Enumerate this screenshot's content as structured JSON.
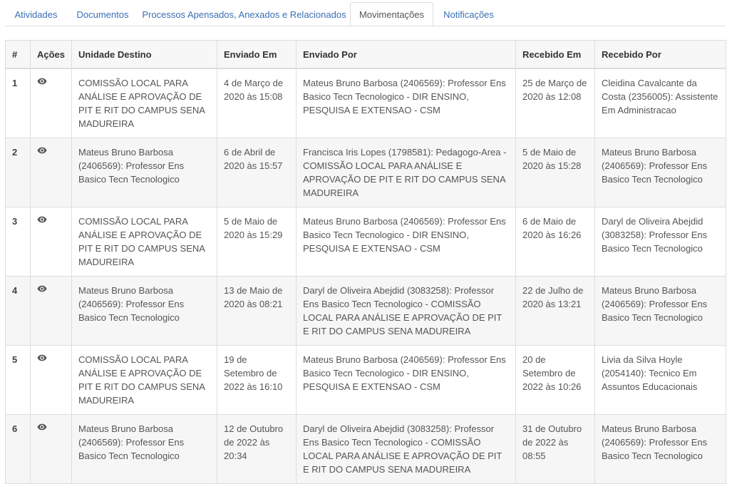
{
  "tabs": [
    {
      "label": "Atividades",
      "active": false
    },
    {
      "label": "Documentos",
      "active": false
    },
    {
      "label": "Processos Apensados, Anexados e Relacionados",
      "active": false
    },
    {
      "label": "Movimentações",
      "active": true
    },
    {
      "label": "Notificações",
      "active": false
    }
  ],
  "table": {
    "headers": {
      "num": "#",
      "acoes": "Ações",
      "unidade_destino": "Unidade Destino",
      "enviado_em": "Enviado Em",
      "enviado_por": "Enviado Por",
      "recebido_em": "Recebido Em",
      "recebido_por": "Recebido Por"
    },
    "rows": [
      {
        "num": "1",
        "unidade_destino": "COMISSÃO LOCAL PARA ANÁLISE E APROVAÇÃO DE PIT E RIT DO CAMPUS SENA MADUREIRA",
        "enviado_em": "4 de Março de 2020 às 15:08",
        "enviado_por": "Mateus Bruno Barbosa (2406569): Professor Ens Basico Tecn Tecnologico - DIR ENSINO, PESQUISA E EXTENSAO - CSM",
        "recebido_em": "25 de Março de 2020 às 12:08",
        "recebido_por": "Cleidina Cavalcante da Costa (2356005): Assistente Em Administracao"
      },
      {
        "num": "2",
        "unidade_destino": "Mateus Bruno Barbosa (2406569): Professor Ens Basico Tecn Tecnologico",
        "enviado_em": "6 de Abril de 2020 às 15:57",
        "enviado_por": "Francisca Iris Lopes (1798581): Pedagogo-Area - COMISSÃO LOCAL PARA ANÁLISE E APROVAÇÃO DE PIT E RIT DO CAMPUS SENA MADUREIRA",
        "recebido_em": "5 de Maio de 2020 às 15:28",
        "recebido_por": "Mateus Bruno Barbosa (2406569): Professor Ens Basico Tecn Tecnologico"
      },
      {
        "num": "3",
        "unidade_destino": "COMISSÃO LOCAL PARA ANÁLISE E APROVAÇÃO DE PIT E RIT DO CAMPUS SENA MADUREIRA",
        "enviado_em": "5 de Maio de 2020 às 15:29",
        "enviado_por": "Mateus Bruno Barbosa (2406569): Professor Ens Basico Tecn Tecnologico - DIR ENSINO, PESQUISA E EXTENSAO - CSM",
        "recebido_em": "6 de Maio de 2020 às 16:26",
        "recebido_por": "Daryl de Oliveira Abejdid (3083258): Professor Ens Basico Tecn Tecnologico"
      },
      {
        "num": "4",
        "unidade_destino": "Mateus Bruno Barbosa (2406569): Professor Ens Basico Tecn Tecnologico",
        "enviado_em": "13 de Maio de 2020 às 08:21",
        "enviado_por": "Daryl de Oliveira Abejdid (3083258): Professor Ens Basico Tecn Tecnologico - COMISSÃO LOCAL PARA ANÁLISE E APROVAÇÃO DE PIT E RIT DO CAMPUS SENA MADUREIRA",
        "recebido_em": "22 de Julho de 2020 às 13:21",
        "recebido_por": "Mateus Bruno Barbosa (2406569): Professor Ens Basico Tecn Tecnologico"
      },
      {
        "num": "5",
        "unidade_destino": "COMISSÃO LOCAL PARA ANÁLISE E APROVAÇÃO DE PIT E RIT DO CAMPUS SENA MADUREIRA",
        "enviado_em": "19 de Setembro de 2022 às 16:10",
        "enviado_por": "Mateus Bruno Barbosa (2406569): Professor Ens Basico Tecn Tecnologico - DIR ENSINO, PESQUISA E EXTENSAO - CSM",
        "recebido_em": "20 de Setembro de 2022 às 10:26",
        "recebido_por": "Livia da Silva Hoyle (2054140): Tecnico Em Assuntos Educacionais"
      },
      {
        "num": "6",
        "unidade_destino": "Mateus Bruno Barbosa (2406569): Professor Ens Basico Tecn Tecnologico",
        "enviado_em": "12 de Outubro de 2022 às 20:34",
        "enviado_por": "Daryl de Oliveira Abejdid (3083258): Professor Ens Basico Tecn Tecnologico - COMISSÃO LOCAL PARA ANÁLISE E APROVAÇÃO DE PIT E RIT DO CAMPUS SENA MADUREIRA",
        "recebido_em": "31 de Outubro de 2022 às 08:55",
        "recebido_por": "Mateus Bruno Barbosa (2406569): Professor Ens Basico Tecn Tecnologico"
      }
    ]
  },
  "icons": {
    "row_action": "eye-icon"
  },
  "colors": {
    "link": "#3a6fb5",
    "text": "#555555",
    "border": "#dddddd",
    "header_bg": "#f7f7f7",
    "stripe": "#f6f6f6"
  }
}
